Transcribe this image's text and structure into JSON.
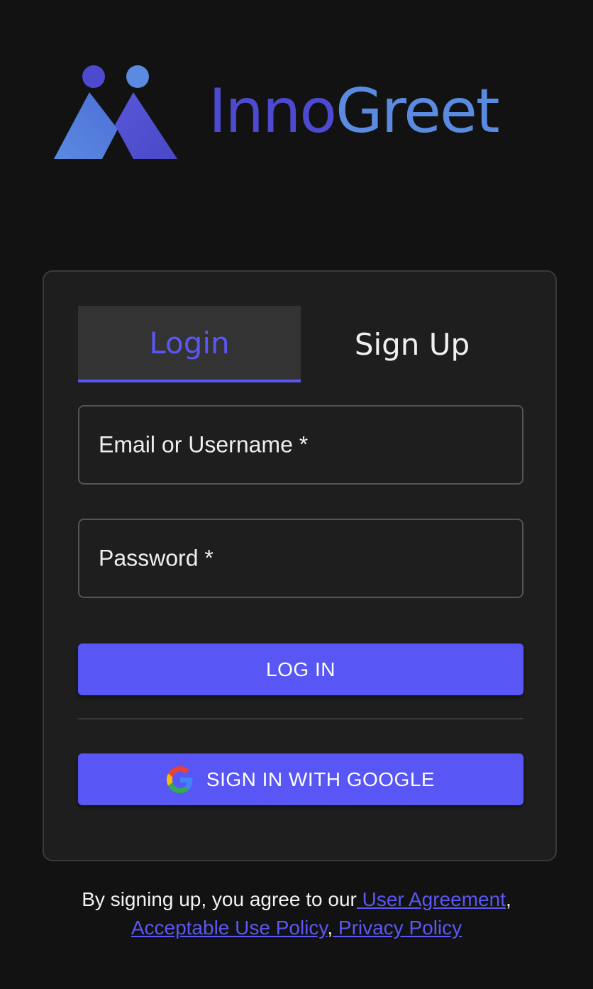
{
  "brand": {
    "name_part1": "Inno",
    "name_part2": "Greet",
    "colors": {
      "dark_blue": "#4e4ad0",
      "light_blue": "#5a8be0",
      "accent": "#5856f5"
    }
  },
  "auth": {
    "tabs": [
      {
        "label": "Login",
        "active": true
      },
      {
        "label": "Sign Up",
        "active": false
      }
    ],
    "email_field": {
      "label": "Email or Username *",
      "value": ""
    },
    "password_field": {
      "label": "Password *",
      "value": ""
    },
    "login_button": "LOG IN",
    "google_button": {
      "label": "SIGN IN WITH GOOGLE",
      "icon": "google-icon"
    }
  },
  "terms": {
    "prefix": "By signing up, you agree to our",
    "user_agreement": " User Agreement",
    "comma1": ",",
    "acceptable_use": "Acceptable Use Policy",
    "comma2": ",",
    "privacy_policy": " Privacy Policy"
  }
}
